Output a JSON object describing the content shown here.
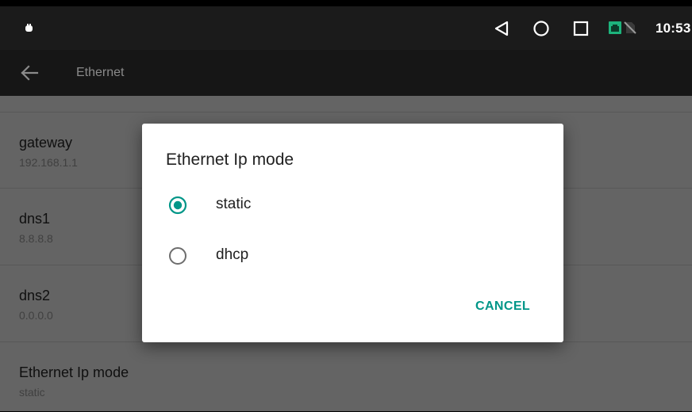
{
  "status_bar": {
    "time": "10:53",
    "icons": [
      "notification-dot-icon",
      "nav-back-icon",
      "nav-home-icon",
      "nav-recents-icon",
      "ethernet-icon",
      "no-sim-icon"
    ]
  },
  "toolbar": {
    "title": "Ethernet"
  },
  "settings": {
    "items": [
      {
        "title": "gateway",
        "summary": "192.168.1.1"
      },
      {
        "title": "dns1",
        "summary": "8.8.8.8"
      },
      {
        "title": "dns2",
        "summary": "0.0.0.0"
      },
      {
        "title": "Ethernet Ip mode",
        "summary": "static"
      }
    ]
  },
  "dialog": {
    "title": "Ethernet Ip mode",
    "options": [
      {
        "label": "static",
        "selected": true
      },
      {
        "label": "dhcp",
        "selected": false
      }
    ],
    "cancel_label": "CANCEL"
  },
  "colors": {
    "accent": "#009688",
    "status_bar": "#1b1b1b",
    "toolbar": "#161616",
    "dim_background": "#646464"
  }
}
